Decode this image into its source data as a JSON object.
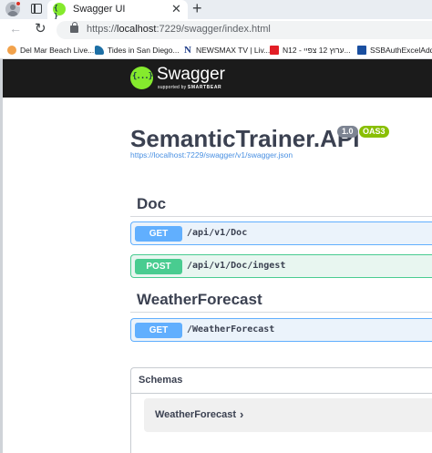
{
  "browser": {
    "tab_title": "Swagger UI",
    "tab_close": "✕",
    "new_tab": "+",
    "back": "←",
    "reload": "↻",
    "url_prefix": "https://",
    "url_host": "localhost",
    "url_rest": ":7229/swagger/index.html",
    "bookmarks": [
      {
        "label": "Del Mar Beach Live...",
        "icon": "sun-icon"
      },
      {
        "label": "Tides in San Diego...",
        "icon": "wave-icon"
      },
      {
        "label": "NEWSMAX TV | Liv...",
        "icon": "newsmax-icon"
      },
      {
        "label": "N12 - ערוץ 12 צפיי...",
        "icon": "n12-icon"
      },
      {
        "label": "SSBAuthExcelAddin",
        "icon": "ssb-icon"
      }
    ]
  },
  "swagger": {
    "brand": "Swagger",
    "supported_by": "supported by",
    "smartbear": "SMARTBEAR"
  },
  "info": {
    "title": "SemanticTrainer.API",
    "version": "1.0",
    "oas": "OAS3",
    "spec_url": "https://localhost:7229/swagger/v1/swagger.json"
  },
  "tags": [
    {
      "name": "Doc",
      "operations": [
        {
          "method": "GET",
          "path": "/api/v1/Doc"
        },
        {
          "method": "POST",
          "path": "/api/v1/Doc/ingest"
        }
      ]
    },
    {
      "name": "WeatherForecast",
      "operations": [
        {
          "method": "GET",
          "path": "/WeatherForecast"
        }
      ]
    }
  ],
  "schemas": {
    "title": "Schemas",
    "models": [
      {
        "name": "WeatherForecast",
        "chevron": "›"
      }
    ]
  },
  "colors": {
    "get": "#61affe",
    "post": "#49cc90",
    "topbar": "#1b1b1b",
    "swagger_green": "#85ea2d",
    "oas_badge": "#89bf04",
    "text": "#3b4151",
    "link": "#4990e2"
  }
}
